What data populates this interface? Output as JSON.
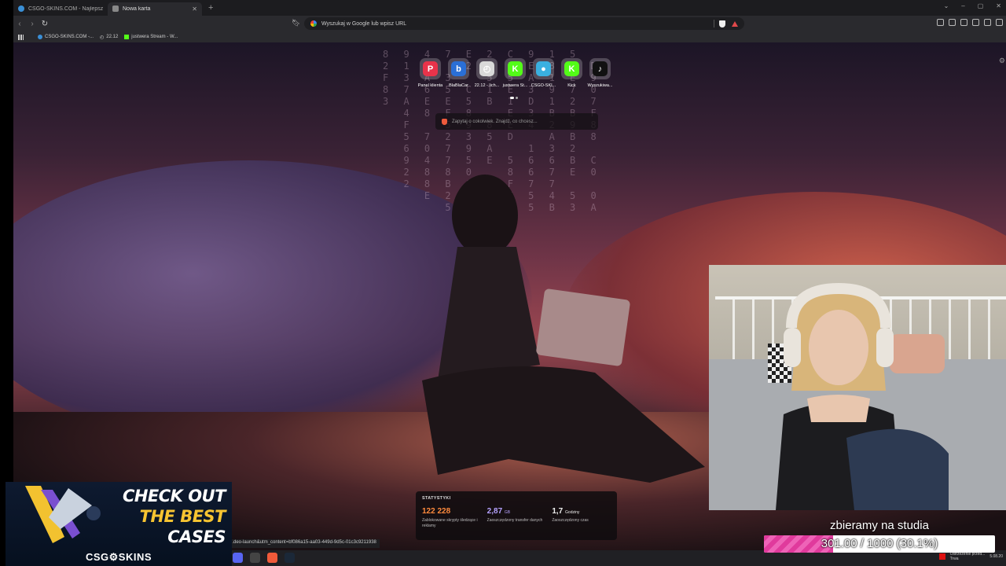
{
  "tabs": [
    {
      "label": "CSGO-SKINS.COM - Najlepsze Skrzy",
      "active": false
    },
    {
      "label": "Nowa karta",
      "active": true
    }
  ],
  "toolbar": {
    "url_placeholder": "Wyszukaj w Google lub wpisz URL"
  },
  "bookmarks": [
    {
      "label": "CSGO-SKINS.COM -...",
      "icon": "globe-icon"
    },
    {
      "label": "22.12",
      "icon": "clock-icon"
    },
    {
      "label": "justwera Stream - W...",
      "icon": "kick-icon"
    }
  ],
  "speed_dial": [
    {
      "label": "Panel klienta",
      "icon": "paysafe-icon",
      "color": "#e8334a",
      "glyph": "P"
    },
    {
      "label": "BlaBlaCar",
      "icon": "blablacar-icon",
      "color": "#2a6fd6",
      "glyph": "b"
    },
    {
      "label": "22.12 - lich...",
      "icon": "clock-icon",
      "color": "#d9d9d9",
      "glyph": "◴"
    },
    {
      "label": "justwera St...",
      "icon": "kick-icon",
      "color": "#53fc18",
      "glyph": "K"
    },
    {
      "label": "CSGO-SKI...",
      "icon": "csgo-skins-icon",
      "color": "#3ab0e0",
      "glyph": "●"
    },
    {
      "label": "Kick",
      "icon": "kick-icon",
      "color": "#53fc18",
      "glyph": "K"
    },
    {
      "label": "Wyszukiwa...",
      "icon": "tiktok-icon",
      "color": "#111111",
      "glyph": "♪"
    }
  ],
  "search": {
    "placeholder": "Zapytaj o cokolwiek. Znajdź, co chcesz..."
  },
  "stats": {
    "heading": "STATYSTYKI",
    "items": [
      {
        "value": "122 228",
        "unit": "",
        "desc": "Zablokowane skrypty śledzące i reklamy",
        "color": "#ff8a3d"
      },
      {
        "value": "2,87",
        "unit": "GB",
        "desc": "Zaoszczędzony transfer danych",
        "color": "#b6a2ff"
      },
      {
        "value": "1,7",
        "unit": "Godziny",
        "desc": "Zaoszczędzony czas",
        "color": "#eeeeee"
      }
    ]
  },
  "status_url": "...deo-launch&utm_content=bf086a15-aa03-449d-9d5c-01c3c9211938",
  "taskbar": {
    "notification": "Ostrzeżenie przed...",
    "notification_sub": "Trwa",
    "date": "5.08.20"
  },
  "stream": {
    "goal_title": "zbieramy na studia",
    "goal_text": "301.00 / 1000 (30.1%)",
    "goal_fraction": 0.301,
    "goal_color": "#e03a9c"
  },
  "ad": {
    "line1": "CHECK OUT",
    "line2": "THE BEST",
    "line3": "CASES",
    "brand": "CSG⚙SKINS"
  }
}
